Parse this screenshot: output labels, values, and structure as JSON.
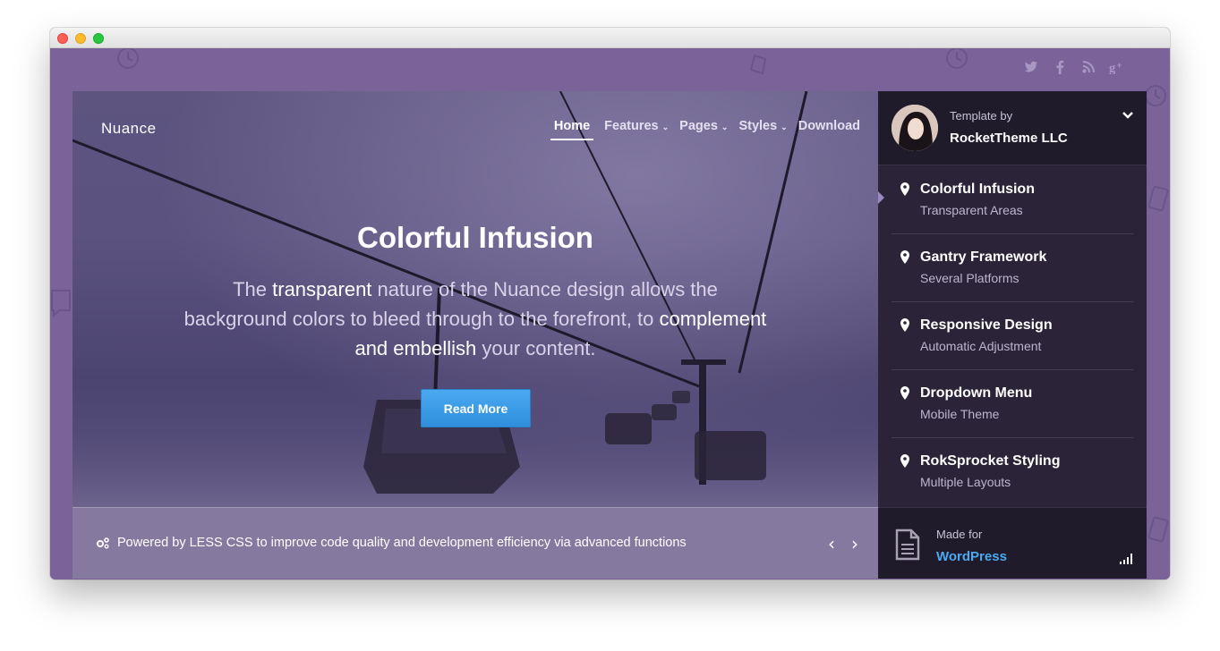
{
  "window": {
    "buttons": [
      "close",
      "minimize",
      "maximize"
    ]
  },
  "social": {
    "icons": [
      "twitter-icon",
      "facebook-icon",
      "rss-icon",
      "google-plus-icon"
    ]
  },
  "header": {
    "brand": "Nuance",
    "nav": [
      {
        "label": "Home",
        "active": true,
        "has_dropdown": false
      },
      {
        "label": "Features",
        "active": false,
        "has_dropdown": true
      },
      {
        "label": "Pages",
        "active": false,
        "has_dropdown": true
      },
      {
        "label": "Styles",
        "active": false,
        "has_dropdown": true
      },
      {
        "label": "Download",
        "active": false,
        "has_dropdown": false
      }
    ]
  },
  "hero": {
    "title": "Colorful Infusion",
    "text_parts": [
      "The ",
      "transparent",
      " nature of the Nuance design allows the background colors to bleed through to the forefront, to ",
      "complement",
      " and ",
      "embellish",
      " your content."
    ],
    "button": "Read More"
  },
  "ticker": {
    "text": "Powered by LESS CSS to improve code quality and development efficiency via advanced functions",
    "prev_icon": "chevron-left-icon",
    "next_icon": "chevron-right-icon"
  },
  "sidebar": {
    "template_by": "Template by",
    "author": "RocketTheme LLC",
    "items": [
      {
        "title": "Colorful Infusion",
        "subtitle": "Transparent Areas"
      },
      {
        "title": "Gantry Framework",
        "subtitle": "Several Platforms"
      },
      {
        "title": "Responsive Design",
        "subtitle": "Automatic Adjustment"
      },
      {
        "title": "Dropdown Menu",
        "subtitle": "Mobile Theme"
      },
      {
        "title": "RokSprocket Styling",
        "subtitle": "Multiple Layouts"
      }
    ],
    "made_for": "Made for",
    "platform": "WordPress"
  },
  "colors": {
    "page_bg": "#7b639a",
    "accent_blue": "#4ba9f0",
    "sidebar_bg": "#2b2438"
  }
}
